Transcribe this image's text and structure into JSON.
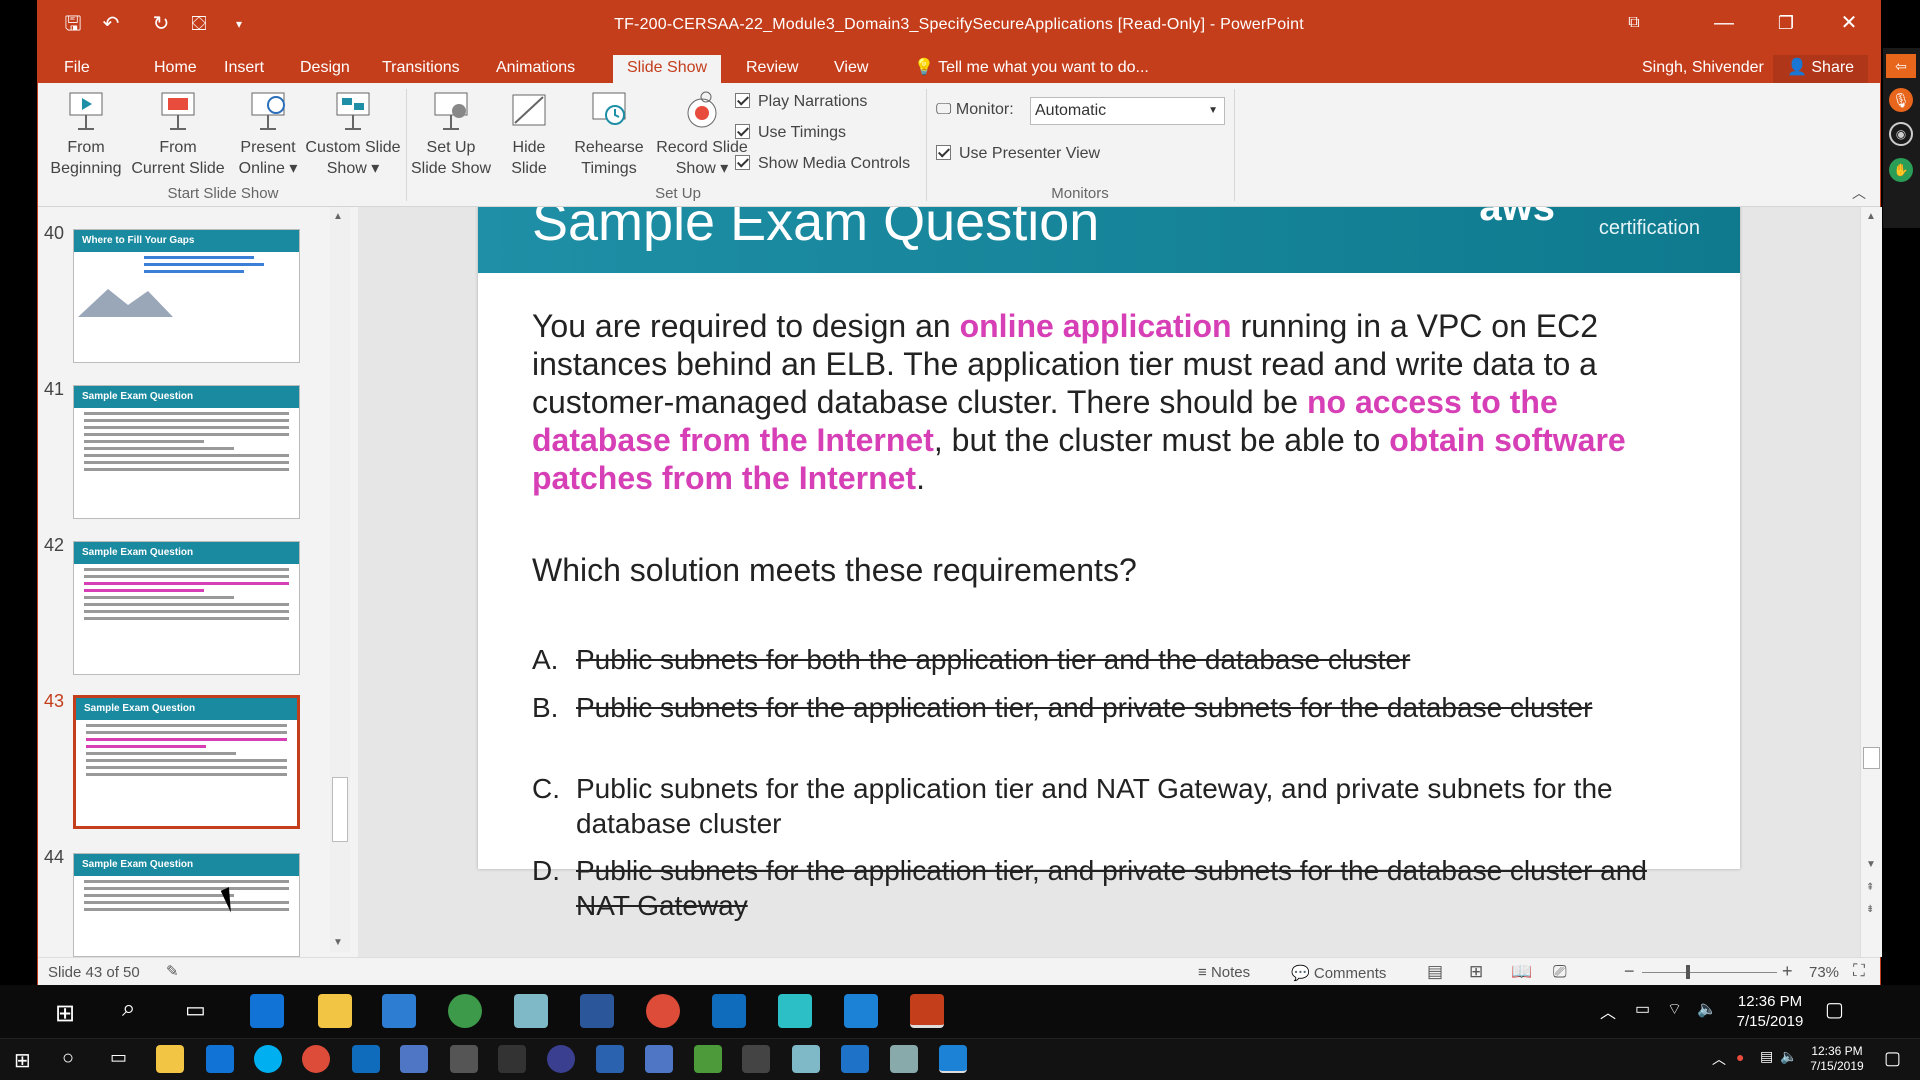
{
  "window": {
    "title": "TF-200-CERSAA-22_Module3_Domain3_SpecifySecureApplications [Read-Only] - PowerPoint"
  },
  "tabs": [
    "File",
    "Home",
    "Insert",
    "Design",
    "Transitions",
    "Animations",
    "Slide Show",
    "Review",
    "View"
  ],
  "active_tab": "Slide Show",
  "tell_me": "Tell me what you want to do...",
  "user": "Singh, Shivender",
  "share": "Share",
  "ribbon": {
    "from_beginning": [
      "From",
      "Beginning"
    ],
    "from_current": [
      "From",
      "Current Slide"
    ],
    "present_online": [
      "Present",
      "Online ▾"
    ],
    "custom_show": [
      "Custom Slide",
      "Show ▾"
    ],
    "group_start": "Start Slide Show",
    "setup_show": [
      "Set Up",
      "Slide Show"
    ],
    "hide_slide": [
      "Hide",
      "Slide"
    ],
    "rehearse": [
      "Rehearse",
      "Timings"
    ],
    "record": [
      "Record Slide",
      "Show ▾"
    ],
    "play_narrations": "Play Narrations",
    "use_timings": "Use Timings",
    "show_media": "Show Media Controls",
    "group_setup": "Set Up",
    "monitor_label": "Monitor:",
    "monitor_value": "Automatic",
    "presenter_view": "Use Presenter View",
    "group_monitors": "Monitors"
  },
  "thumbnails": [
    {
      "num": "40",
      "title": "Where to Fill Your Gaps"
    },
    {
      "num": "41",
      "title": "Sample Exam Question"
    },
    {
      "num": "42",
      "title": "Sample Exam Question"
    },
    {
      "num": "43",
      "title": "Sample Exam Question"
    },
    {
      "num": "44",
      "title": "Sample Exam Question"
    }
  ],
  "slide": {
    "title": "Sample Exam Question",
    "logo": "aws",
    "logo_sub": "certification",
    "p1": "You are required to design an ",
    "h1": "online application",
    "p2": " running in a VPC on EC2 instances behind an ELB. The application tier must read and write data to a customer-managed database cluster. There should be ",
    "h2": "no access to the database from the Internet",
    "p3": ", but the cluster must be able to ",
    "h3": "obtain software patches from the Internet",
    "p4": ".",
    "question": "Which solution meets these requirements?",
    "options": [
      {
        "letter": "A.",
        "text": "Public subnets for both the application tier and the database cluster"
      },
      {
        "letter": "B.",
        "text": "Public subnets for the application tier, and private subnets for the database cluster"
      },
      {
        "letter": "C.",
        "text": "Public subnets for the application tier and NAT Gateway, and private subnets for the database cluster"
      },
      {
        "letter": "D.",
        "text": "Public subnets for the application tier, and private subnets for the database cluster and NAT Gateway"
      }
    ]
  },
  "status": {
    "slide": "Slide 43 of 50",
    "notes": "Notes",
    "comments": "Comments",
    "zoom": "73%"
  },
  "clock": {
    "time": "12:36 PM",
    "date": "7/15/2019"
  },
  "clock2": {
    "time": "12:36 PM",
    "date": "7/15/2019"
  }
}
